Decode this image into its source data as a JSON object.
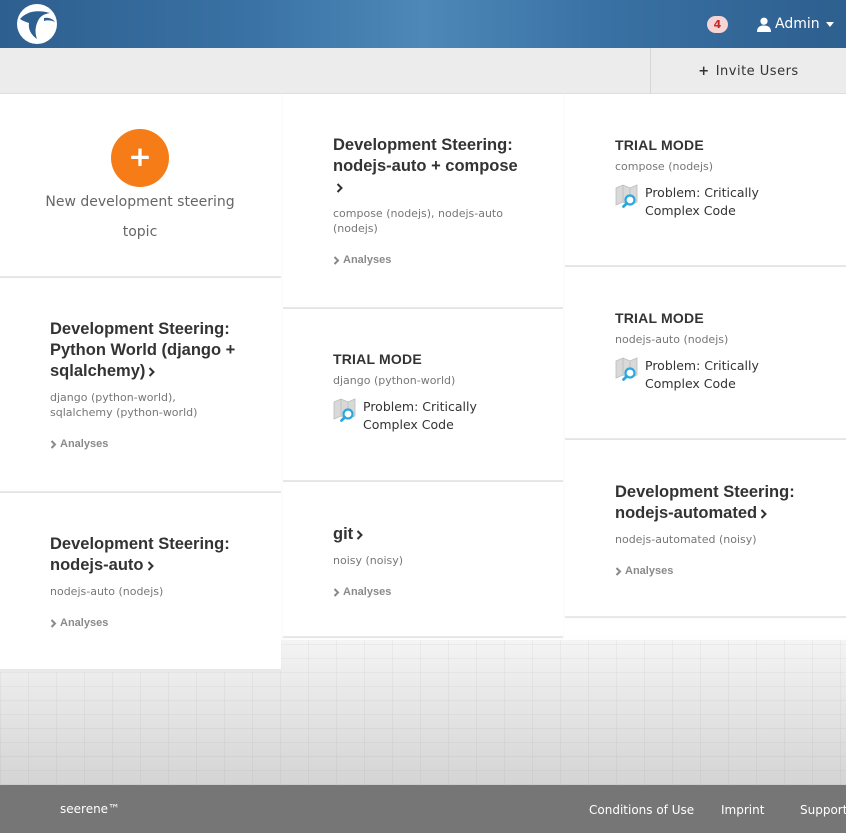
{
  "header": {
    "notifications_count": "4",
    "user_label": "Admin"
  },
  "subbar": {
    "invite_label": "Invite Users"
  },
  "new_topic": {
    "plus": "+",
    "label": "New development steering topic"
  },
  "cards": {
    "python_world": {
      "title": "Development Steering: Python World (django + sqlalchemy)",
      "subtitle": "django (python-world), sqlalchemy (python-world)",
      "link": "Analyses"
    },
    "nodejs_auto": {
      "title": "Development Steering: nodejs-auto",
      "subtitle": "nodejs-auto (nodejs)",
      "link": "Analyses"
    },
    "nodejs_compose": {
      "title": "Development Steering: nodejs-auto + compose",
      "subtitle": "compose (nodejs), nodejs-auto (nodejs)",
      "link": "Analyses"
    },
    "trial_django": {
      "title": "TRIAL MODE",
      "subtitle": "django (python-world)",
      "problem": "Problem: Critically Complex Code"
    },
    "git": {
      "title": "git",
      "subtitle": "noisy (noisy)",
      "link": "Analyses"
    },
    "trial_compose": {
      "title": "TRIAL MODE",
      "subtitle": "compose (nodejs)",
      "problem": "Problem: Critically Complex Code"
    },
    "trial_nodejs_auto": {
      "title": "TRIAL MODE",
      "subtitle": "nodejs-auto (nodejs)",
      "problem": "Problem: Critically Complex Code"
    },
    "nodejs_automated": {
      "title": "Development Steering: nodejs-automated",
      "subtitle": "nodejs-automated (noisy)",
      "link": "Analyses"
    }
  },
  "footer": {
    "brand": "seerene™",
    "conditions": "Conditions of Use",
    "imprint": "Imprint",
    "support": "Support"
  },
  "colors": {
    "navbar": "#3a72a5",
    "accent_orange": "#f57c16",
    "footer": "#767676",
    "problem_icon": "#29a8e0"
  },
  "icons": [
    "logo-bird",
    "user-icon",
    "caret-down-icon",
    "plus-icon",
    "chevron-right-icon",
    "problem-map-search-icon"
  ]
}
